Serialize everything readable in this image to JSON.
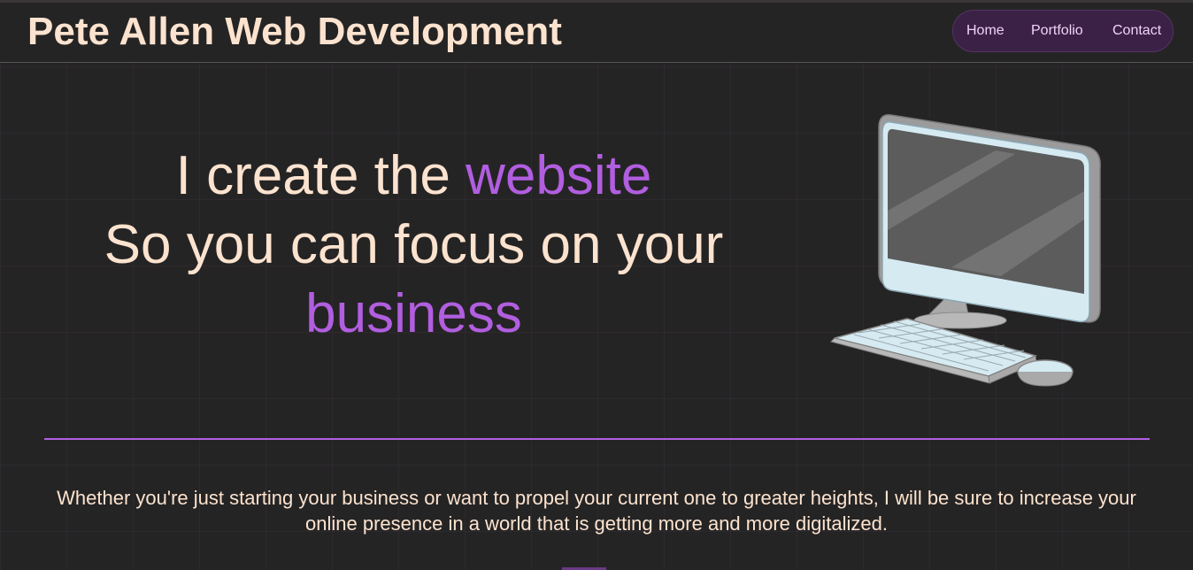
{
  "header": {
    "title": "Pete Allen Web Development"
  },
  "nav": {
    "items": [
      {
        "label": "Home"
      },
      {
        "label": "Portfolio"
      },
      {
        "label": "Contact"
      }
    ]
  },
  "hero": {
    "line1_prefix": "I create the ",
    "line1_accent": "website",
    "line2": "So you can focus on your",
    "line3_accent": "business"
  },
  "illustration": {
    "icon": "desktop-computer-icon"
  },
  "tagline": {
    "text": "Whether you're just starting your business or want to propel your current one to greater heights, I will be sure to increase your online presence in a world that is getting more and more digitalized."
  },
  "colors": {
    "background": "#252424",
    "text": "#fce3cf",
    "accent": "#b15ee0",
    "nav_background": "#3a2145"
  }
}
